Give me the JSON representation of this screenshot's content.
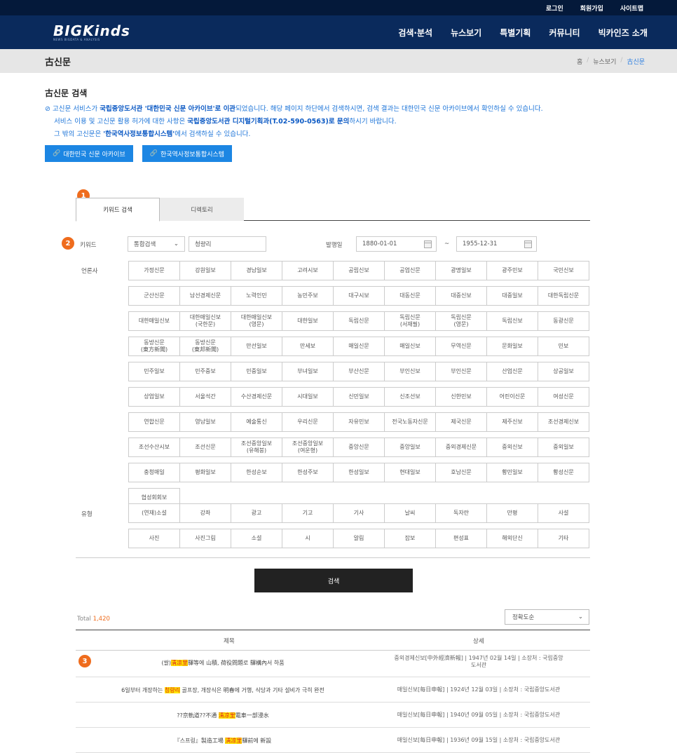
{
  "topbar": {
    "links": [
      "로그인",
      "회원가입",
      "사이트맵"
    ]
  },
  "header": {
    "logo": "BIGKinds",
    "logo_sub": "NEWS BIGDATA & ANALYSIS",
    "nav": [
      "검색·분석",
      "뉴스보기",
      "특별기획",
      "커뮤니티",
      "빅카인즈 소개"
    ]
  },
  "page": {
    "title": "古신문",
    "breadcrumb": [
      "홈",
      "뉴스보기",
      "古신문"
    ]
  },
  "intro": {
    "heading": "古신문 검색",
    "line1_a": "⊘ 고신문 서비스가 ",
    "line1_b": "국립중앙도서관 '대한민국 신문 아카이브'로 이관",
    "line1_c": "되었습니다. 해당 페이지 하단에서 검색하시면, 검색 결과는 대한민국 신문 아카이브에서 확인하실 수 있습니다.",
    "line2_a": "서비스 이용 및 고신문 활용 허가에 대한 사항은 ",
    "line2_b": "국립중앙도서관 디지털기획과(T.02-590-0563)로 문의",
    "line2_c": "하시기 바랍니다.",
    "line3_a": "그 밖의 고신문은 ",
    "line3_b": "'한국역사정보통합시스템'",
    "line3_c": "에서 검색하실 수 있습니다.",
    "btn1": "대한민국 신문 아카이브",
    "btn2": "한국역사정보통합시스템"
  },
  "badges": [
    "1",
    "2",
    "3"
  ],
  "tabs": [
    "키워드 검색",
    "디렉토리"
  ],
  "form": {
    "keyword_label": "키워드",
    "search_type": "통합검색",
    "keyword_value": "청량리",
    "date_label": "발행일",
    "date_from": "1880-01-01",
    "date_sep": "~",
    "date_to": "1955-12-31",
    "press_label": "언론사",
    "type_label": "유형"
  },
  "press": [
    "가정신문",
    "강원일보",
    "경남일보",
    "고려시보",
    "공립신보",
    "공업신문",
    "광명일보",
    "광주민보",
    "국민신보",
    "군산신문",
    "남선경제신문",
    "노력인민",
    "농민주보",
    "대구시보",
    "대동신문",
    "대중신보",
    "대중일보",
    "대한독립신문",
    "대한매일신보",
    "대한매일신보\n(국한문)",
    "대한매일신보\n(영문)",
    "대한일보",
    "독립신문",
    "독립신문\n(서재필)",
    "독립신문\n(영문)",
    "독립신보",
    "동광신문",
    "동방신문\n(東方新聞)",
    "동방신문\n(東邦新聞)",
    "만선일보",
    "만세보",
    "매일신문",
    "매일신보",
    "무역신문",
    "문화일보",
    "민보",
    "민주일보",
    "민주중보",
    "민중일보",
    "부녀일보",
    "부산신문",
    "부인신보",
    "부인신문",
    "산업신문",
    "상공일보",
    "상업일보",
    "서울석간",
    "수산경제신문",
    "시대일보",
    "신민일보",
    "신조선보",
    "신한민보",
    "어린이신문",
    "여성신문",
    "연합신문",
    "영남일보",
    "예술통신",
    "우리신문",
    "자유민보",
    "전국노동자신문",
    "제국신문",
    "제주신보",
    "조선경제신보",
    "조선수산시보",
    "조선신문",
    "조선중앙일보\n(유해붕)",
    "조선중앙일보\n(여운형)",
    "중앙신문",
    "중앙일보",
    "중외경제신문",
    "중외신보",
    "중외일보",
    "충청매일",
    "평화일보",
    "한성순보",
    "한성주보",
    "한성일보",
    "현대일보",
    "호남신문",
    "황민일보",
    "황성신문",
    "협성회회보"
  ],
  "types": [
    "(연재)소설",
    "강좌",
    "광고",
    "기고",
    "기사",
    "날씨",
    "독자란",
    "만평",
    "사설",
    "사진",
    "사진그림",
    "소설",
    "시",
    "알림",
    "잡보",
    "편성표",
    "해외단신",
    "기타"
  ],
  "search_button": "검색",
  "results": {
    "total_label": "Total",
    "total_count": "1,420",
    "sort": "정확도순",
    "col_title": "제목",
    "col_detail": "상세",
    "rows": [
      {
        "pre": "(쌀)",
        "hl": "淸凉里",
        "post": "驛等에 山積, 荷役問題로 驛構內서 하품",
        "detail": "중외경제신보[中外經濟新報] | 1947년 02월 14일 | 소장처 : 국립중앙\n도서관"
      },
      {
        "pre": "6일부터 개장하는 ",
        "hl": "청량리",
        "post": " 골프장, 개장식은 明春에 거행, 식당과 기타 설비가 극히 완전",
        "detail": "매일신보[每日申報] | 1924년 12월 03일 | 소장처 : 국립중앙도서관"
      },
      {
        "pre": "??京軌道??不通 ",
        "hl": "淸凉里",
        "post": "電車一部浸水",
        "detail": "매일신보[每日申報] | 1940년 09월 05일 | 소장처 : 국립중앙도서관"
      },
      {
        "pre": "『스프링』製造工場 ",
        "hl": "淸凉里",
        "post": "驛前에 新設",
        "detail": "매일신보[每日申報] | 1936년 09월 15일 | 소장처 : 국립중앙도서관"
      }
    ]
  }
}
